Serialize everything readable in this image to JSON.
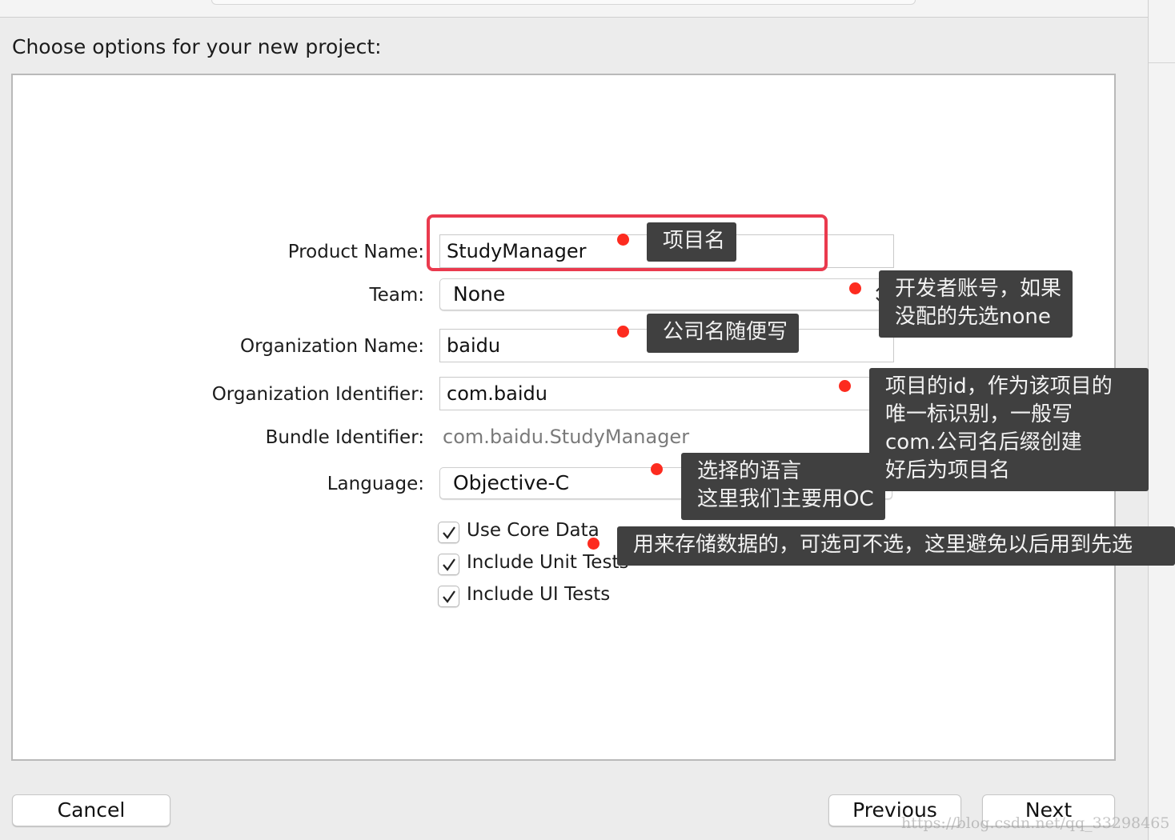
{
  "dialog": {
    "heading": "Choose options for your new project:"
  },
  "form": {
    "product_name": {
      "label": "Product Name:",
      "value": "StudyManager"
    },
    "team": {
      "label": "Team:",
      "value": "None"
    },
    "organization_name": {
      "label": "Organization Name:",
      "value": "baidu"
    },
    "organization_identifier": {
      "label": "Organization Identifier:",
      "value": "com.baidu"
    },
    "bundle_identifier": {
      "label": "Bundle Identifier:",
      "value": "com.baidu.StudyManager"
    },
    "language": {
      "label": "Language:",
      "value": "Objective-C"
    },
    "checkboxes": [
      {
        "label": "Use Core Data",
        "checked": true
      },
      {
        "label": "Include Unit Tests",
        "checked": true
      },
      {
        "label": "Include UI Tests",
        "checked": true
      }
    ]
  },
  "annotations": {
    "product_name": {
      "lines": [
        "项目名"
      ]
    },
    "team": {
      "lines": [
        "开发者账号，如果",
        "没配的先选none"
      ]
    },
    "organization_name": {
      "lines": [
        "公司名随便写"
      ]
    },
    "organization_identifier": {
      "lines": [
        "项目的id，作为该项目的",
        "唯一标识别，一般写",
        "com.公司名后缀创建",
        "好后为项目名"
      ]
    },
    "language": {
      "lines": [
        "选择的语言",
        "这里我们主要用OC"
      ]
    },
    "core_data": {
      "lines": [
        "用来存储数据的，可选可不选，这里避免以后用到先选"
      ]
    }
  },
  "buttons": {
    "cancel": "Cancel",
    "previous": "Previous",
    "next": "Next"
  },
  "watermark": "https://blog.csdn.net/qq_33298465",
  "colors": {
    "highlight_border": "#ea3a4e",
    "dot": "#fd2b1f",
    "note_bg": "#404040"
  }
}
